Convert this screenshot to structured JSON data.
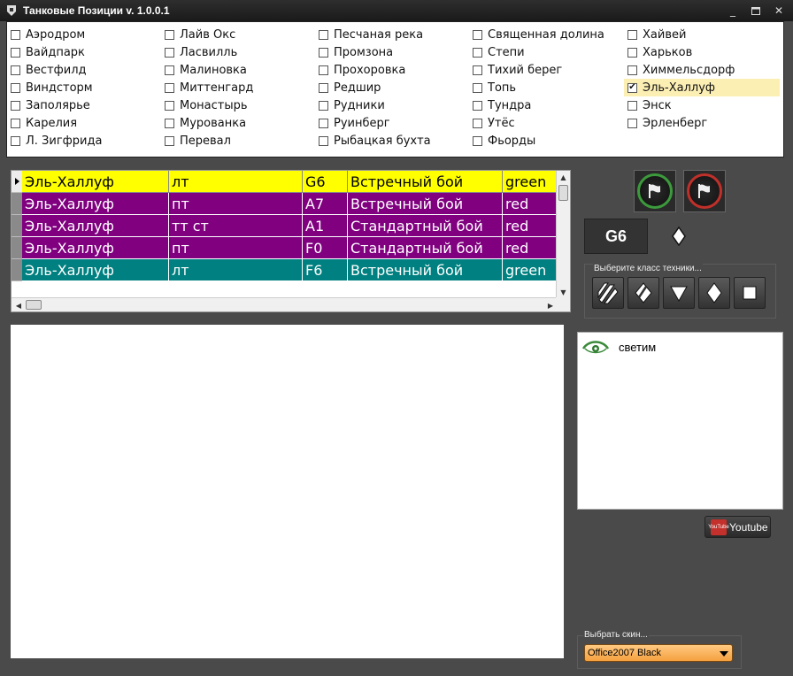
{
  "window": {
    "title": "Танковые Позиции v. 1.0.0.1",
    "minimize": "_",
    "close": "✕"
  },
  "maps": {
    "columns": [
      [
        {
          "label": "Аэродром",
          "checked": false
        },
        {
          "label": "Вайдпарк",
          "checked": false
        },
        {
          "label": "Вестфилд",
          "checked": false
        },
        {
          "label": "Виндсторм",
          "checked": false
        },
        {
          "label": "Заполярье",
          "checked": false
        },
        {
          "label": "Карелия",
          "checked": false
        },
        {
          "label": "Л. Зигфрида",
          "checked": false
        }
      ],
      [
        {
          "label": "Лайв Окс",
          "checked": false
        },
        {
          "label": "Ласвилль",
          "checked": false
        },
        {
          "label": "Малиновка",
          "checked": false
        },
        {
          "label": "Миттенгард",
          "checked": false
        },
        {
          "label": "Монастырь",
          "checked": false
        },
        {
          "label": "Мурованка",
          "checked": false
        },
        {
          "label": "Перевал",
          "checked": false
        }
      ],
      [
        {
          "label": "Песчаная река",
          "checked": false
        },
        {
          "label": "Промзона",
          "checked": false
        },
        {
          "label": "Прохоровка",
          "checked": false
        },
        {
          "label": "Редшир",
          "checked": false
        },
        {
          "label": "Рудники",
          "checked": false
        },
        {
          "label": "Руинберг",
          "checked": false
        },
        {
          "label": "Рыбацкая бухта",
          "checked": false
        }
      ],
      [
        {
          "label": "Священная долина",
          "checked": false
        },
        {
          "label": "Степи",
          "checked": false
        },
        {
          "label": "Тихий берег",
          "checked": false
        },
        {
          "label": "Топь",
          "checked": false
        },
        {
          "label": "Тундра",
          "checked": false
        },
        {
          "label": "Утёс",
          "checked": false
        },
        {
          "label": "Фьорды",
          "checked": false
        }
      ],
      [
        {
          "label": "Хайвей",
          "checked": false
        },
        {
          "label": "Харьков",
          "checked": false
        },
        {
          "label": "Химмельсдорф",
          "checked": false
        },
        {
          "label": "Эль-Халлуф",
          "checked": true
        },
        {
          "label": "Энск",
          "checked": false
        },
        {
          "label": "Эрленберг",
          "checked": false
        }
      ]
    ]
  },
  "positions": {
    "rows": [
      {
        "map": "Эль-Халлуф",
        "class": "лт",
        "square": "G6",
        "mode": "Встречный бой",
        "team": "green",
        "color": "yellow"
      },
      {
        "map": "Эль-Халлуф",
        "class": "пт",
        "square": "A7",
        "mode": "Встречный бой",
        "team": "red",
        "color": "purple"
      },
      {
        "map": "Эль-Халлуф",
        "class": "тт ст",
        "square": "A1",
        "mode": "Стандартный бой",
        "team": "red",
        "color": "purple"
      },
      {
        "map": "Эль-Халлуф",
        "class": "пт",
        "square": "F0",
        "mode": "Стандартный бой",
        "team": "red",
        "color": "purple"
      },
      {
        "map": "Эль-Халлуф",
        "class": "лт",
        "square": "F6",
        "mode": "Встречный бой",
        "team": "green",
        "color": "teal"
      }
    ]
  },
  "selected": {
    "square": "G6"
  },
  "class_selector": {
    "legend": "Выберите класс техники..."
  },
  "log": {
    "items": [
      {
        "label": "светим",
        "icon": "eye-icon"
      }
    ]
  },
  "youtube": {
    "logo_you": "You",
    "logo_tube": "Tube",
    "label": "Youtube"
  },
  "skin": {
    "legend": "Выбрать скин...",
    "value": "Office2007 Black"
  },
  "colors": {
    "yellow": "#ffff00",
    "purple": "#800080",
    "teal": "#008080",
    "checked_bg": "#fcefb4"
  }
}
